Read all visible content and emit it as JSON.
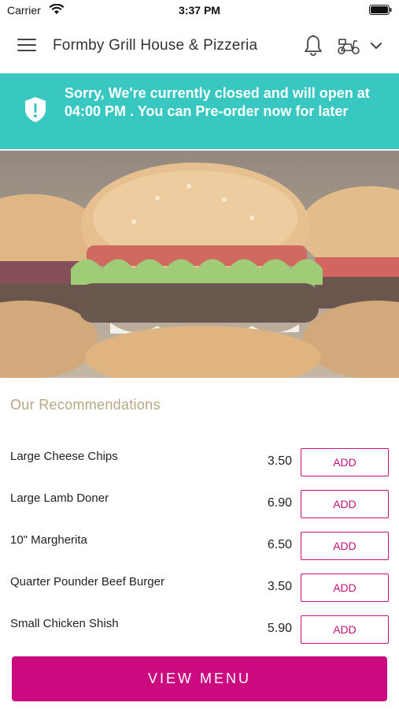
{
  "status_bar": {
    "carrier": "Carrier",
    "time": "3:37 PM"
  },
  "header": {
    "title": "Formby Grill House & Pizzeria",
    "icons": [
      "menu-icon",
      "bell-icon",
      "scooter-icon",
      "chevron-down-icon"
    ]
  },
  "banner": {
    "message": "Sorry, We're currently closed and will open at 04:00 PM . You can Pre-order now for later",
    "icon": "shield-icon",
    "color": "#39c8c1"
  },
  "hero": {
    "description_icon": "burger-image"
  },
  "recommendations": {
    "title": "Our Recommendations",
    "items": [
      {
        "name": "Large Cheese Chips",
        "price": "3.50",
        "button": "ADD"
      },
      {
        "name": "Large Lamb Doner",
        "price": "6.90",
        "button": "ADD"
      },
      {
        "name": "10\" Margherita",
        "price": "6.50",
        "button": "ADD"
      },
      {
        "name": "Quarter Pounder Beef Burger",
        "price": "3.50",
        "button": "ADD"
      },
      {
        "name": "Small Chicken Shish",
        "price": "5.90",
        "button": "ADD"
      }
    ]
  },
  "footer": {
    "view_menu_label": "VIEW MENU",
    "accent_color": "#cc0a7f"
  }
}
